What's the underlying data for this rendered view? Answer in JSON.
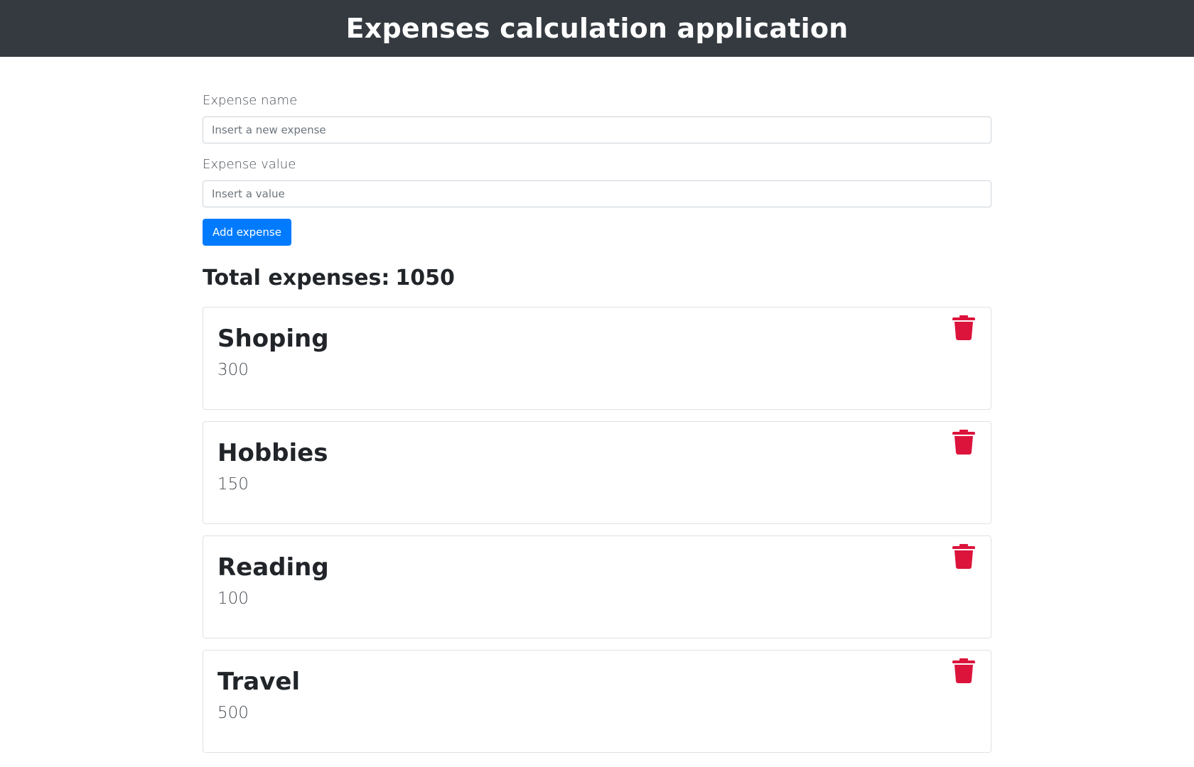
{
  "header": {
    "title": "Expenses calculation application"
  },
  "form": {
    "name_label": "Expense name",
    "name_placeholder": "Insert a new expense",
    "name_value": "",
    "value_label": "Expense value",
    "value_placeholder": "Insert a value",
    "value_value": "",
    "add_button_label": "Add expense"
  },
  "summary": {
    "total_label": "Total expenses:",
    "total_value": "1050"
  },
  "expenses": [
    {
      "name": "Shoping",
      "value": "300",
      "delete_icon": "trash-icon"
    },
    {
      "name": "Hobbies",
      "value": "150",
      "delete_icon": "trash-icon"
    },
    {
      "name": "Reading",
      "value": "100",
      "delete_icon": "trash-icon"
    },
    {
      "name": "Travel",
      "value": "500",
      "delete_icon": "trash-icon"
    }
  ],
  "colors": {
    "header_bg": "#343a40",
    "primary": "#007bff",
    "danger": "#dc143c"
  }
}
